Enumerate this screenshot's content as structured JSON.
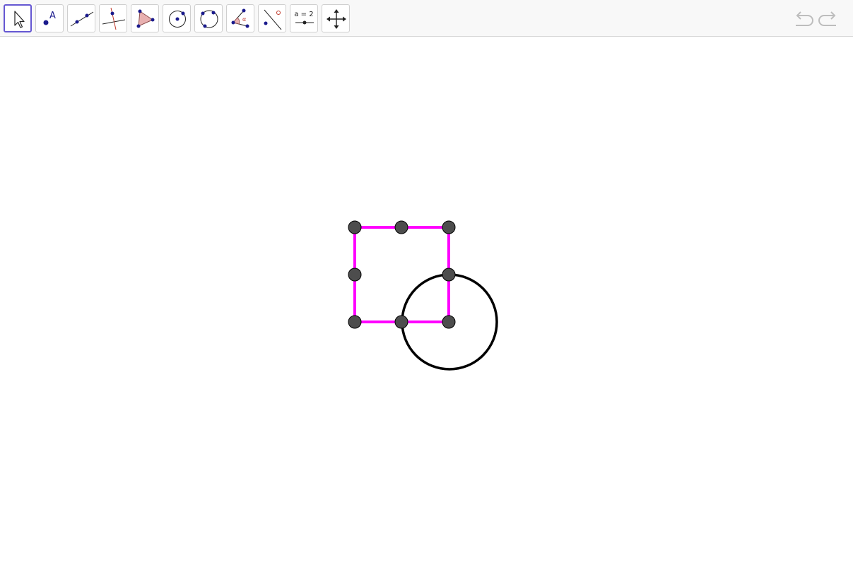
{
  "toolbar": {
    "tools": [
      {
        "name": "move-tool",
        "icon": "pointer-arrow-icon",
        "selected": true
      },
      {
        "name": "point-tool",
        "icon": "point-with-label-icon",
        "label": "A"
      },
      {
        "name": "line-tool",
        "icon": "line-through-two-points-icon"
      },
      {
        "name": "perpendicular-line-tool",
        "icon": "perpendicular-line-icon"
      },
      {
        "name": "polygon-tool",
        "icon": "triangle-polygon-icon"
      },
      {
        "name": "circle-tool",
        "icon": "circle-center-point-icon"
      },
      {
        "name": "circle-three-points-tool",
        "icon": "circle-through-three-points-icon"
      },
      {
        "name": "angle-tool",
        "icon": "angle-icon",
        "label": "α"
      },
      {
        "name": "reflect-tool",
        "icon": "reflect-about-line-icon"
      },
      {
        "name": "slider-tool",
        "icon": "slider-icon",
        "label": "a = 2"
      },
      {
        "name": "move-graphics-view-tool",
        "icon": "move-cross-arrows-icon"
      }
    ],
    "undo": {
      "icon": "undo-icon"
    },
    "redo": {
      "icon": "redo-icon"
    }
  },
  "colors": {
    "accent": "#6557d2",
    "square_stroke": "#ff00ff",
    "circle_stroke": "#000000",
    "point_fill": "#4d4d4d",
    "icon_point": "#1a1a8c",
    "icon_red": "#c0392b"
  }
}
